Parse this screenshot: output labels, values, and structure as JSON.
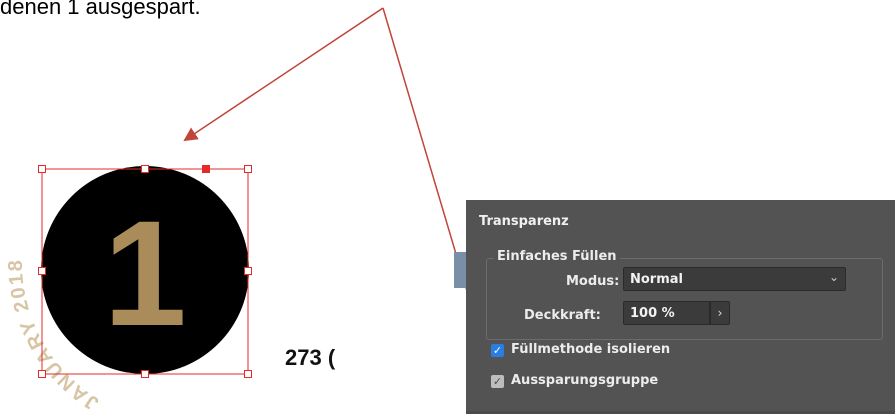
{
  "caption": {
    "text": "denen 1 ausgespart."
  },
  "artwork": {
    "big_digit": "1",
    "arc_text": "JANUARY 2018",
    "side_text": "273 (",
    "colors": {
      "circle": "#000000",
      "digit": "#a98c5a",
      "frame": "#e32b2b",
      "arrow": "#c0463c",
      "arc_text": "#d7c5a6"
    }
  },
  "panel": {
    "title": "Transparenz",
    "group_title": "Einfaches Füllen",
    "modus_label": "Modus:",
    "modus_value": "Normal",
    "modus_arrow_icon": "chevron-down-icon",
    "opacity_label": "Deckkraft:",
    "opacity_value": "100 %",
    "opacity_button_icon": "chevron-right-icon",
    "checkboxes": [
      {
        "label": "Füllmethode isolieren",
        "checked": true
      },
      {
        "label": "Aussparungsgruppe",
        "checked": true
      }
    ],
    "colors": {
      "background": "#535353",
      "field": "#3b3b3b",
      "accent": "#2a7de1"
    }
  }
}
